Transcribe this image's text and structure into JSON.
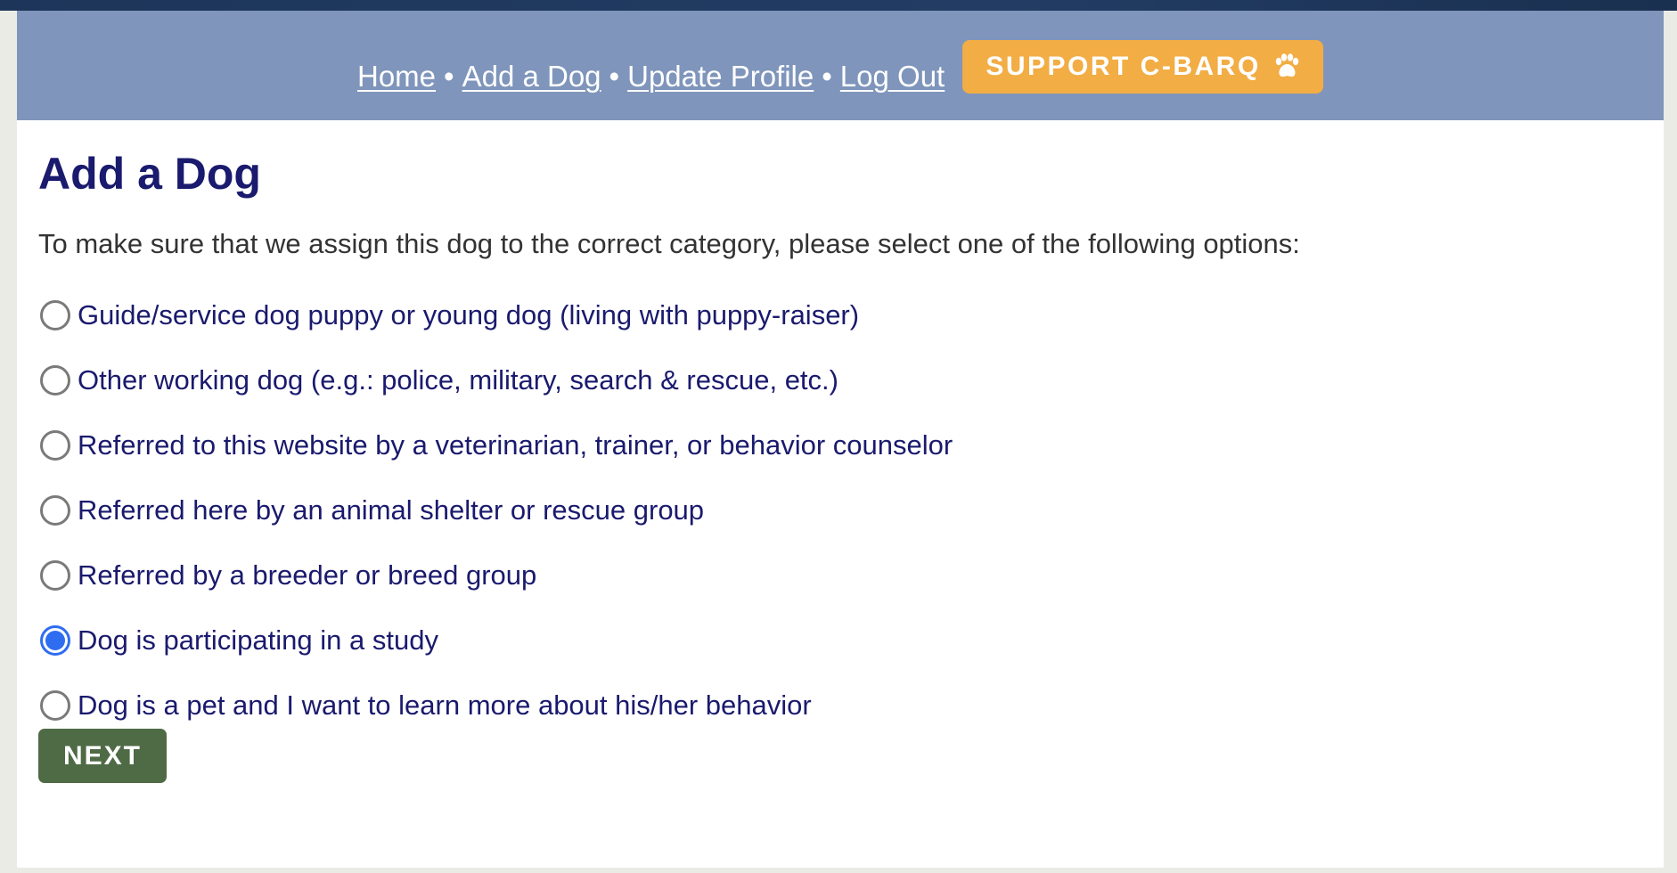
{
  "nav": {
    "links": [
      "Home",
      "Add a Dog",
      "Update Profile",
      "Log Out"
    ],
    "separator": "•"
  },
  "support_button": {
    "label": "SUPPORT C-BARQ",
    "icon": "paw-icon",
    "color": "#f2ad45"
  },
  "page": {
    "title": "Add a Dog",
    "intro": "To make sure that we assign this dog to the correct category, please select one of the following options:"
  },
  "options": [
    {
      "label": "Guide/service dog puppy or young dog (living with puppy-raiser)",
      "checked": false
    },
    {
      "label": "Other working dog (e.g.: police, military, search & rescue, etc.)",
      "checked": false
    },
    {
      "label": "Referred to this website by a veterinarian, trainer, or behavior counselor",
      "checked": false
    },
    {
      "label": "Referred here by an animal shelter or rescue group",
      "checked": false
    },
    {
      "label": "Referred by a breeder or breed group",
      "checked": false
    },
    {
      "label": "Dog is participating in a study",
      "checked": true
    },
    {
      "label": "Dog is a pet and I want to learn more about his/her behavior",
      "checked": false
    }
  ],
  "next_button": {
    "label": "NEXT",
    "color": "#4f6b45"
  },
  "colors": {
    "header_bg": "#7f95bb",
    "heading_text": "#1a1a6e",
    "radio_checked": "#2f6df0"
  }
}
